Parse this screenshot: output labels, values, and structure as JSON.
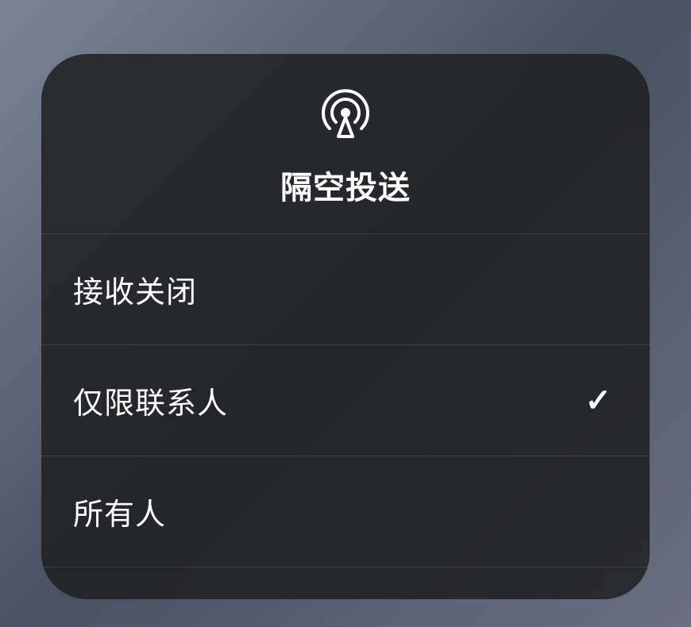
{
  "panel": {
    "title": "隔空投送",
    "icon_name": "airdrop-icon",
    "options": [
      {
        "label": "接收关闭",
        "selected": false
      },
      {
        "label": "仅限联系人",
        "selected": true
      },
      {
        "label": "所有人",
        "selected": false
      }
    ]
  }
}
